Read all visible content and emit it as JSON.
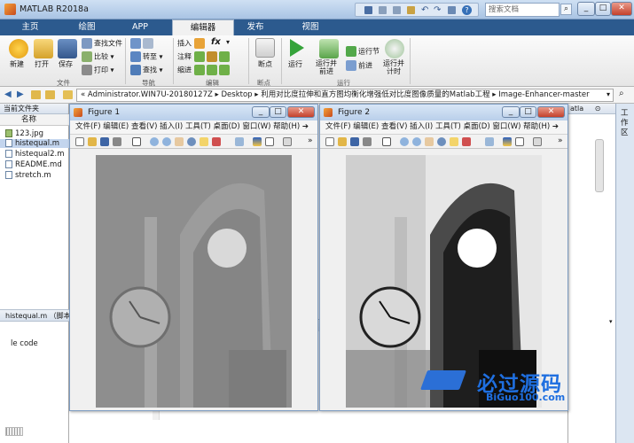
{
  "app": {
    "title": "MATLAB R2018a",
    "search_placeholder": "搜索文档"
  },
  "tabs": [
    "主页",
    "绘图",
    "APP",
    "编辑器",
    "发布",
    "视图"
  ],
  "active_tab": "编辑器",
  "ribbon": {
    "file": {
      "new": "新建",
      "open": "打开",
      "save": "保存",
      "find_files": "查找文件",
      "compare": "比较",
      "print": "打印",
      "section": "文件"
    },
    "nav": {
      "goto": "转至",
      "find": "查找",
      "section": "导航"
    },
    "edit": {
      "insert": "插入",
      "comment": "注释",
      "indent": "缩进",
      "fx": "fx",
      "section": "编辑"
    },
    "breakpoints": {
      "label": "断点",
      "section": "断点"
    },
    "run": {
      "run": "运行",
      "run_advance": "运行并\n前进",
      "run_section": "运行节",
      "advance": "前进",
      "run_time": "运行并\n计时",
      "section": "运行"
    }
  },
  "address": {
    "segments": [
      "«",
      "Administrator.WIN7U-20180127Z",
      "Desktop",
      "利用对比度拉伸和直方图均衡化增强低对比度图像质量的Matlab工程",
      "Image-Enhancer-master"
    ]
  },
  "current_folder": {
    "header": "当前文件夹",
    "column": "名称",
    "files": [
      {
        "name": "123.jpg",
        "type": "image"
      },
      {
        "name": "histequal.m",
        "type": "m"
      },
      {
        "name": "histequal2.m",
        "type": "m"
      },
      {
        "name": "README.md",
        "type": "text"
      },
      {
        "name": "stretch.m",
        "type": "m"
      }
    ],
    "details_title": "histequal.m （脚本",
    "details_text": "le code"
  },
  "right_panel": {
    "label": "atla",
    "workspace_label": "工作区"
  },
  "figures": [
    {
      "title": "Figure 1"
    },
    {
      "title": "Figure 2"
    }
  ],
  "figure_menu": [
    "文件(F)",
    "编辑(E)",
    "查看(V)",
    "插入(I)",
    "工具(T)",
    "桌面(D)",
    "窗口(W)",
    "帮助(H)"
  ],
  "watermark": {
    "text": "必过源码",
    "url": "BiGuo100.com"
  },
  "colors": {
    "tab_bar": "#2c5a8e",
    "title_bar": "#bcd3ee",
    "figure_title": "#c8daf0"
  }
}
